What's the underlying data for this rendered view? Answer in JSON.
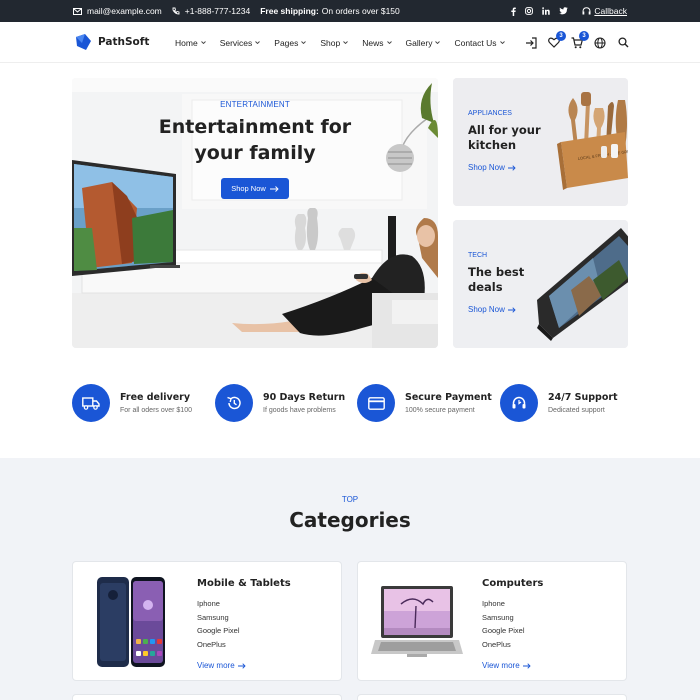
{
  "topbar": {
    "email": "mail@example.com",
    "phone": "+1-888-777-1234",
    "shipping_strong": "Free shipping:",
    "shipping_text": "On orders over $150",
    "callback": "Callback"
  },
  "brand": {
    "name": "PathSoft",
    "accent": "#1a56d6"
  },
  "menu": [
    {
      "label": "Home"
    },
    {
      "label": "Services"
    },
    {
      "label": "Pages"
    },
    {
      "label": "Shop"
    },
    {
      "label": "News"
    },
    {
      "label": "Gallery"
    },
    {
      "label": "Contact Us"
    }
  ],
  "header_icons": {
    "wishlist_count": "3",
    "cart_count": "3"
  },
  "hero": {
    "eyebrow": "ENTERTAINMENT",
    "title_line1": "Entertainment for",
    "title_line2": "your family",
    "button": "Shop Now"
  },
  "promos": [
    {
      "tag": "APPLIANCES",
      "title_line1": "All for your",
      "title_line2": "kitchen",
      "link": "Shop Now",
      "crate_text": "LOCAL & FRESH · THE GREEN MARKET"
    },
    {
      "tag": "TECH",
      "title_line1": "The best",
      "title_line2": "deals",
      "link": "Shop Now"
    }
  ],
  "features": [
    {
      "title": "Free delivery",
      "subtitle": "For all oders over $100",
      "icon": "truck-icon"
    },
    {
      "title": "90 Days Return",
      "subtitle": "If goods have problems",
      "icon": "return-clock-icon"
    },
    {
      "title": "Secure Payment",
      "subtitle": "100% secure payment",
      "icon": "card-icon"
    },
    {
      "title": "24/7 Support",
      "subtitle": "Dedicated support",
      "icon": "headset-icon"
    }
  ],
  "categories": {
    "eyebrow": "TOP",
    "title": "Categories",
    "cards": [
      {
        "title": "Mobile & Tablets",
        "items": [
          "Iphone",
          "Samsung",
          "Google Pixel",
          "OnePlus"
        ],
        "link": "View more"
      },
      {
        "title": "Computers",
        "items": [
          "Iphone",
          "Samsung",
          "Google Pixel",
          "OnePlus"
        ],
        "link": "View more"
      }
    ]
  }
}
